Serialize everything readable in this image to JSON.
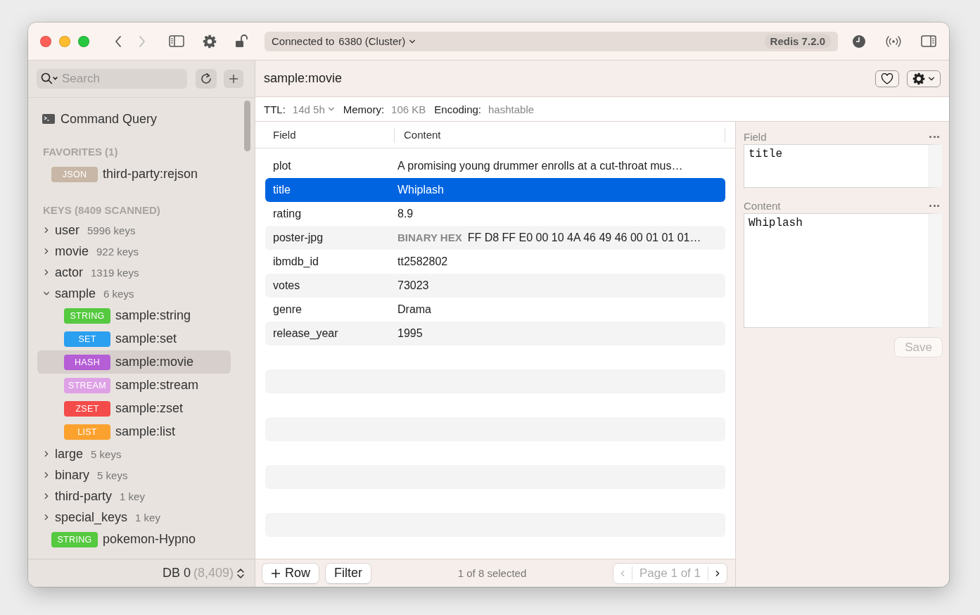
{
  "window": {
    "nav": [
      {
        "kind": "back",
        "disabled": false
      },
      {
        "kind": "forward",
        "disabled": true
      }
    ],
    "connection": {
      "label": "Connected to",
      "target": "6380 (Cluster)"
    },
    "version": "Redis 7.2.0"
  },
  "sidebar": {
    "search": {
      "placeholder": "Search"
    },
    "command_query": "Command Query",
    "favorites": {
      "heading": "FAVORITES (1)",
      "items": [
        {
          "type": "JSON",
          "color": "#c8b7a6",
          "name": "third-party:rejson"
        }
      ]
    },
    "keys": {
      "heading": "KEYS (8409 SCANNED)",
      "items": [
        {
          "kind": "group",
          "name": "user",
          "count": "5996 keys",
          "expanded": false
        },
        {
          "kind": "group",
          "name": "movie",
          "count": "922 keys",
          "expanded": false
        },
        {
          "kind": "group",
          "name": "actor",
          "count": "1319 keys",
          "expanded": false
        },
        {
          "kind": "group",
          "name": "sample",
          "count": "6 keys",
          "expanded": true,
          "children": [
            {
              "type": "STRING",
              "color": "#55c93f",
              "name": "sample:string",
              "selected": false
            },
            {
              "type": "SET",
              "color": "#2b9ff0",
              "name": "sample:set",
              "selected": false
            },
            {
              "type": "HASH",
              "color": "#b55ed6",
              "name": "sample:movie",
              "selected": true
            },
            {
              "type": "STREAM",
              "color": "#dea1e6",
              "name": "sample:stream",
              "selected": false
            },
            {
              "type": "ZSET",
              "color": "#f34c4a",
              "name": "sample:zset",
              "selected": false
            },
            {
              "type": "LIST",
              "color": "#fba12e",
              "name": "sample:list",
              "selected": false
            }
          ]
        },
        {
          "kind": "group",
          "name": "large",
          "count": "5 keys",
          "expanded": false
        },
        {
          "kind": "group",
          "name": "binary",
          "count": "5 keys",
          "expanded": false
        },
        {
          "kind": "group",
          "name": "third-party",
          "count": "1 key",
          "expanded": false
        },
        {
          "kind": "group",
          "name": "special_keys",
          "count": "1 key",
          "expanded": false
        },
        {
          "kind": "key",
          "type": "STRING",
          "color": "#55c93f",
          "name": "pokemon-Hypno",
          "selected": false
        }
      ]
    },
    "footer": {
      "db": "DB 0",
      "count": "(8,409)"
    }
  },
  "key": {
    "title": "sample:movie",
    "info": [
      {
        "label": "TTL:",
        "value": "14d 5h",
        "menu": true
      },
      {
        "label": "Memory:",
        "value": "106 KB",
        "menu": false
      },
      {
        "label": "Encoding:",
        "value": "hashtable",
        "menu": false
      }
    ]
  },
  "table": {
    "columns": [
      "Field",
      "Content"
    ],
    "rows": [
      {
        "field": "plot",
        "content": "A promising young drummer enrolls at a cut-throat mus…",
        "selected": false
      },
      {
        "field": "title",
        "content": "Whiplash",
        "selected": true
      },
      {
        "field": "rating",
        "content": "8.9",
        "selected": false
      },
      {
        "field": "poster-jpg",
        "tag": "BINARY HEX",
        "content": "FF D8 FF E0 00 10 4A 46 49 46 00 01 01 01…",
        "selected": false
      },
      {
        "field": "ibmdb_id",
        "content": "tt2582802",
        "selected": false
      },
      {
        "field": "votes",
        "content": "73023",
        "selected": false
      },
      {
        "field": "genre",
        "content": "Drama",
        "selected": false
      },
      {
        "field": "release_year",
        "content": "1995",
        "selected": false
      }
    ]
  },
  "editor": {
    "fields": [
      {
        "label": "Field",
        "value": "title"
      },
      {
        "label": "Content",
        "value": "Whiplash"
      }
    ],
    "save": {
      "label": "Save",
      "disabled": true
    }
  },
  "footer": {
    "add_row": "Row",
    "filter": "Filter",
    "status": "1 of 8 selected",
    "pager": {
      "label": "Page 1 of 1",
      "prev_disabled": true,
      "next_disabled": false
    }
  }
}
